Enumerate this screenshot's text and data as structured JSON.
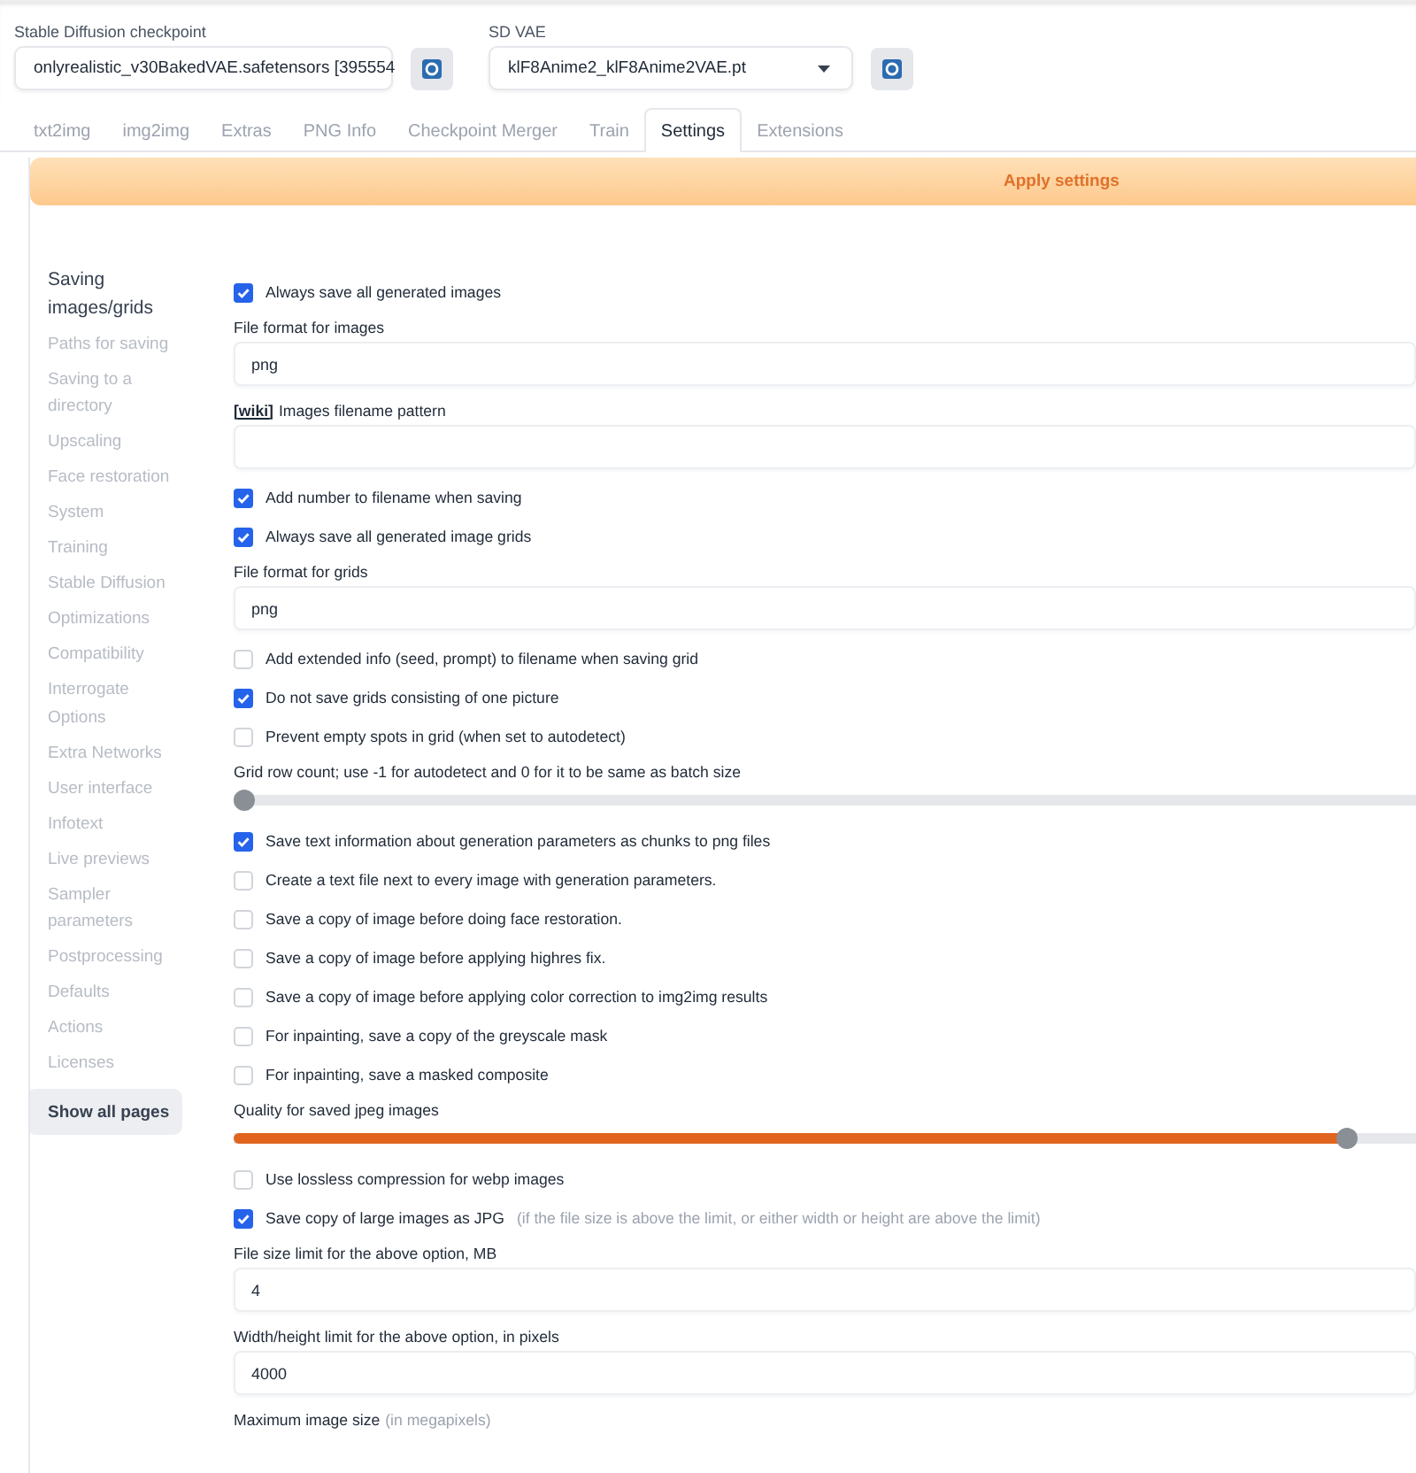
{
  "checkpoint": {
    "label": "Stable Diffusion checkpoint",
    "value": "onlyrealistic_v30BakedVAE.safetensors [395554"
  },
  "vae": {
    "label": "SD VAE",
    "value": "klF8Anime2_klF8Anime2VAE.pt"
  },
  "tabs": [
    {
      "label": "txt2img",
      "selected": false
    },
    {
      "label": "img2img",
      "selected": false
    },
    {
      "label": "Extras",
      "selected": false
    },
    {
      "label": "PNG Info",
      "selected": false
    },
    {
      "label": "Checkpoint Merger",
      "selected": false
    },
    {
      "label": "Train",
      "selected": false
    },
    {
      "label": "Settings",
      "selected": true
    },
    {
      "label": "Extensions",
      "selected": false
    }
  ],
  "apply_button": "Apply settings",
  "sidebar": {
    "items": [
      {
        "label": "Saving images/grids",
        "selected": true
      },
      {
        "label": "Paths for saving",
        "selected": false
      },
      {
        "label": "Saving to a directory",
        "selected": false
      },
      {
        "label": "Upscaling",
        "selected": false
      },
      {
        "label": "Face restoration",
        "selected": false
      },
      {
        "label": "System",
        "selected": false
      },
      {
        "label": "Training",
        "selected": false
      },
      {
        "label": "Stable Diffusion",
        "selected": false
      },
      {
        "label": "Optimizations",
        "selected": false
      },
      {
        "label": "Compatibility",
        "selected": false
      },
      {
        "label": "Interrogate Options",
        "selected": false
      },
      {
        "label": "Extra Networks",
        "selected": false
      },
      {
        "label": "User interface",
        "selected": false
      },
      {
        "label": "Infotext",
        "selected": false
      },
      {
        "label": "Live previews",
        "selected": false
      },
      {
        "label": "Sampler parameters",
        "selected": false
      },
      {
        "label": "Postprocessing",
        "selected": false
      },
      {
        "label": "Defaults",
        "selected": false
      },
      {
        "label": "Actions",
        "selected": false
      },
      {
        "label": "Licenses",
        "selected": false
      }
    ],
    "show_all": "Show all pages"
  },
  "settings": [
    {
      "kind": "checkbox",
      "label": "Always save all generated images",
      "checked": true
    },
    {
      "kind": "field",
      "label": "File format for images",
      "value": "png"
    },
    {
      "kind": "field",
      "link": "[wiki]",
      "label": "Images filename pattern"
    },
    {
      "kind": "checkbox",
      "label": "Add number to filename when saving",
      "checked": true
    },
    {
      "kind": "checkbox",
      "label": "Always save all generated image grids",
      "checked": true
    },
    {
      "kind": "field",
      "label": "File format for grids",
      "value": "png"
    },
    {
      "kind": "checkbox",
      "label": "Add extended info (seed, prompt) to filename when saving grid",
      "checked": false
    },
    {
      "kind": "checkbox",
      "label": "Do not save grids consisting of one picture",
      "checked": true
    },
    {
      "kind": "checkbox",
      "label": "Prevent empty spots in grid (when set to autodetect)",
      "checked": false
    },
    {
      "kind": "slider",
      "label": "Grid row count; use -1 for autodetect and 0 for it to be same as batch size",
      "level": 0
    },
    {
      "kind": "checkbox",
      "label": "Save text information about generation parameters as chunks to png files",
      "checked": true
    },
    {
      "kind": "checkbox",
      "label": "Create a text file next to every image with generation parameters.",
      "checked": false
    },
    {
      "kind": "checkbox",
      "label": "Save a copy of image before doing face restoration.",
      "checked": false
    },
    {
      "kind": "checkbox",
      "label": "Save a copy of image before applying highres fix.",
      "checked": false
    },
    {
      "kind": "checkbox",
      "label": "Save a copy of image before applying color correction to img2img results",
      "checked": false
    },
    {
      "kind": "checkbox",
      "label": "For inpainting, save a copy of the greyscale mask",
      "checked": false
    },
    {
      "kind": "checkbox",
      "label": "For inpainting, save a masked composite",
      "checked": false
    },
    {
      "kind": "slider",
      "label": "Quality for saved jpeg images",
      "level": 0.95
    },
    {
      "kind": "checkbox",
      "label": "Use lossless compression for webp images",
      "checked": false
    },
    {
      "kind": "checkbox",
      "label": "Save copy of large images as JPG",
      "hint": "(if the file size is above the limit, or either width or height are above the limit)",
      "checked": true
    },
    {
      "kind": "field",
      "label": "File size limit for the above option, MB",
      "value": "4"
    },
    {
      "kind": "field",
      "label": "Width/height limit for the above option, in pixels",
      "value": "4000"
    },
    {
      "kind": "label",
      "label": "Maximum image size",
      "hint": "(in megapixels)"
    }
  ]
}
